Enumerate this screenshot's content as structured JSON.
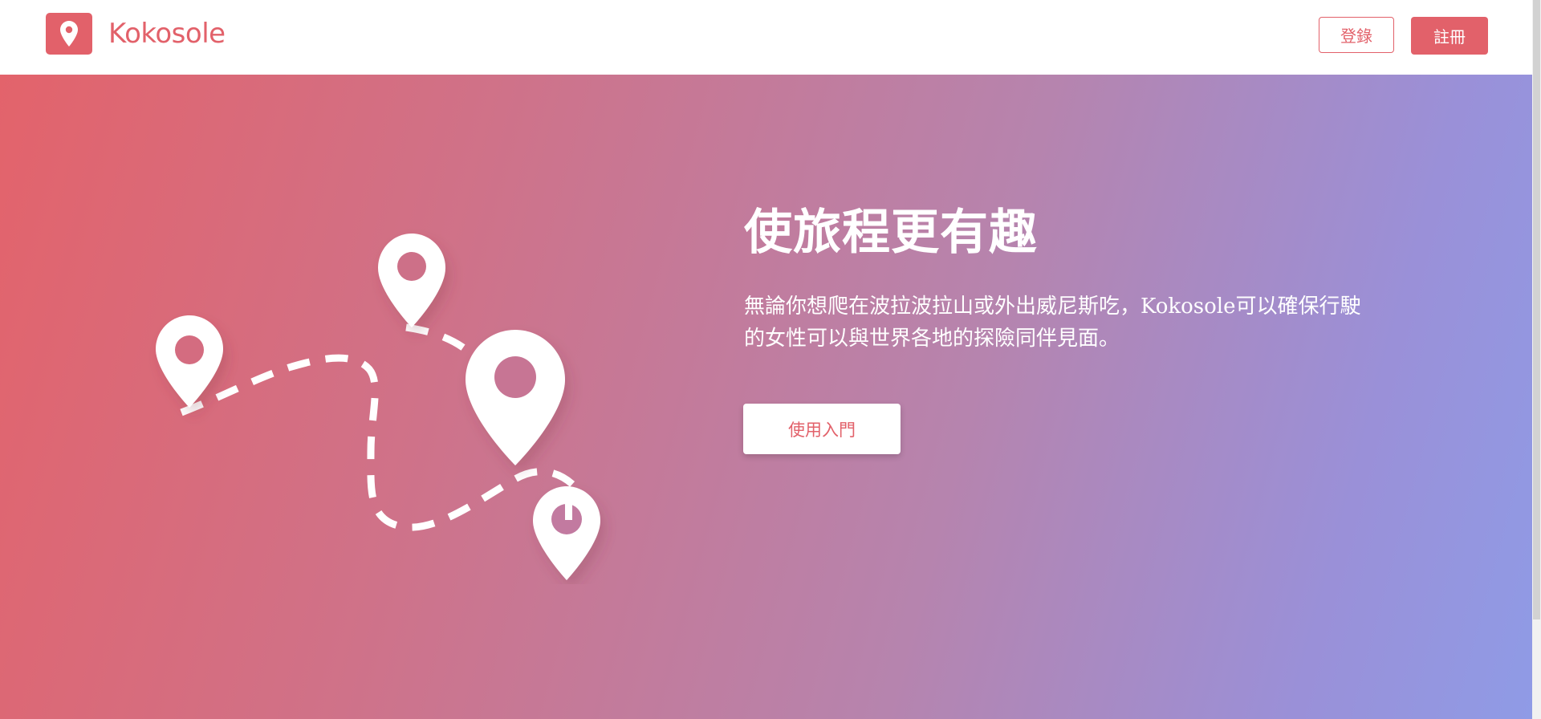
{
  "brand": {
    "name": "Kokosole",
    "logo_icon": "map-pin-icon",
    "color": "#e2616a"
  },
  "nav": {
    "login_label": "登錄",
    "register_label": "註冊"
  },
  "hero": {
    "title": "使旅程更有趣",
    "description": "無論你想爬在波拉波拉山或外出威尼斯吃，Kokosole可以確保行駛的女性可以與世界各地的探險同伴見面。",
    "cta_label": "使用入門",
    "gradient_start": "#e3636b",
    "gradient_end": "#8f9be6",
    "illustration_icon": "map-route-pins-icon"
  }
}
